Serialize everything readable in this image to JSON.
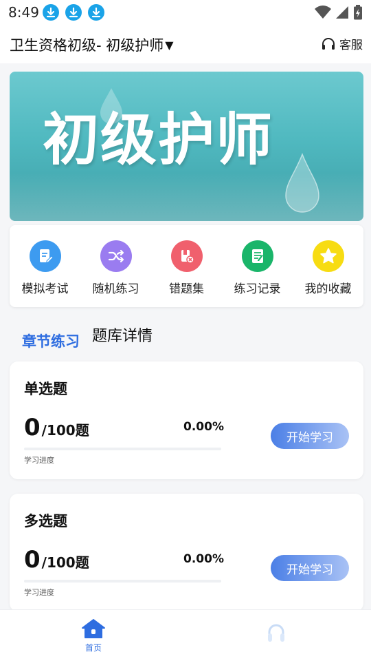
{
  "status_bar": {
    "time": "8:49",
    "download_icons": [
      "download-icon",
      "download-icon",
      "download-icon"
    ],
    "system_icons": [
      "wifi-icon",
      "signal-icon",
      "battery-charging-icon"
    ]
  },
  "header": {
    "title": "卫生资格初级- 初级护师",
    "dropdown_icon": "triangle-down-icon",
    "service_label": "客服",
    "service_icon": "headset-icon"
  },
  "banner": {
    "text": "初级护师"
  },
  "menu": [
    {
      "label": "模拟考试",
      "icon": "exam-icon",
      "color": "#3d9bf0"
    },
    {
      "label": "随机练习",
      "icon": "shuffle-icon",
      "color": "#9a7cf0"
    },
    {
      "label": "错题集",
      "icon": "wrong-set-icon",
      "color": "#f0606d"
    },
    {
      "label": "练习记录",
      "icon": "record-icon",
      "color": "#1ab56a"
    },
    {
      "label": "我的收藏",
      "icon": "star-icon",
      "color": "#f7dc12"
    }
  ],
  "tabs": {
    "active": "章节练习",
    "other": "题库详情"
  },
  "questions": [
    {
      "title": "单选题",
      "done": "0",
      "total_text": "/100题",
      "percent": "0.00%",
      "progress": 0,
      "progress_label": "学习进度",
      "button": "开始学习"
    },
    {
      "title": "多选题",
      "done": "0",
      "total_text": "/100题",
      "percent": "0.00%",
      "progress": 0,
      "progress_label": "学习进度",
      "button": "开始学习"
    }
  ],
  "bottom_nav": {
    "home_label": "首页",
    "home_icon": "home-icon",
    "other_icon": "headset-nav-icon"
  },
  "colors": {
    "accent": "#2e6de0",
    "download": "#1aa3e8"
  }
}
